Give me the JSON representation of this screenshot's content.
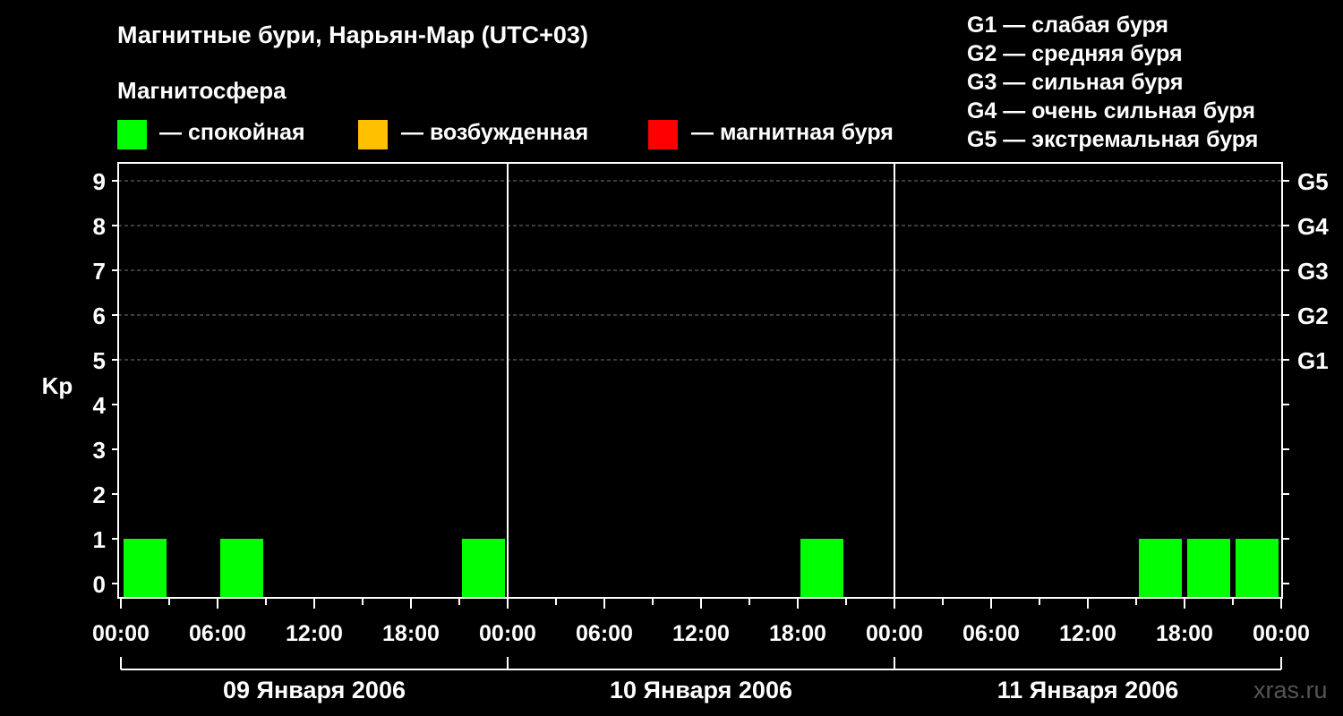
{
  "header": {
    "title": "Магнитные бури, Нарьян-Мар (UTC+03)",
    "subtitle": "Магнитосфера"
  },
  "legend": {
    "items": [
      {
        "label": "— спокойная",
        "color": "#00ff00"
      },
      {
        "label": "— возбужденная",
        "color": "#ffc000"
      },
      {
        "label": "— магнитная буря",
        "color": "#ff0000"
      }
    ]
  },
  "g_legend": [
    "G1 — слабая буря",
    "G2 — средняя буря",
    "G3 — сильная буря",
    "G4 — очень сильная буря",
    "G5 — экстремальная буря"
  ],
  "watermark": "xras.ru",
  "chart_data": {
    "type": "bar",
    "ylabel": "Kp",
    "ylim": [
      0,
      9
    ],
    "yticks": [
      0,
      1,
      2,
      3,
      4,
      5,
      6,
      7,
      8,
      9
    ],
    "right_ticks": [
      {
        "kp": 5,
        "label": "G1"
      },
      {
        "kp": 6,
        "label": "G2"
      },
      {
        "kp": 7,
        "label": "G3"
      },
      {
        "kp": 8,
        "label": "G4"
      },
      {
        "kp": 9,
        "label": "G5"
      }
    ],
    "grid": "dashed horizontal at Kp 5-9",
    "days": [
      "09 Января 2006",
      "10 Января 2006",
      "11 Января 2006"
    ],
    "x_tick_labels": [
      "00:00",
      "06:00",
      "12:00",
      "18:00",
      "00:00",
      "06:00",
      "12:00",
      "18:00",
      "00:00",
      "06:00",
      "12:00",
      "18:00",
      "00:00"
    ],
    "interval_hours": 3,
    "bars": [
      {
        "day": "09 Января 2006",
        "start": "00:00",
        "kp": 1,
        "state": "спокойная",
        "color": "#00ff00"
      },
      {
        "day": "09 Января 2006",
        "start": "06:00",
        "kp": 1,
        "state": "спокойная",
        "color": "#00ff00"
      },
      {
        "day": "09 Января 2006",
        "start": "21:00",
        "kp": 1,
        "state": "спокойная",
        "color": "#00ff00"
      },
      {
        "day": "10 Января 2006",
        "start": "18:00",
        "kp": 1,
        "state": "спокойная",
        "color": "#00ff00"
      },
      {
        "day": "11 Января 2006",
        "start": "15:00",
        "kp": 1,
        "state": "спокойная",
        "color": "#00ff00"
      },
      {
        "day": "11 Января 2006",
        "start": "18:00",
        "kp": 1,
        "state": "спокойная",
        "color": "#00ff00"
      },
      {
        "day": "11 Января 2006",
        "start": "21:00",
        "kp": 1,
        "state": "спокойная",
        "color": "#00ff00"
      }
    ]
  }
}
